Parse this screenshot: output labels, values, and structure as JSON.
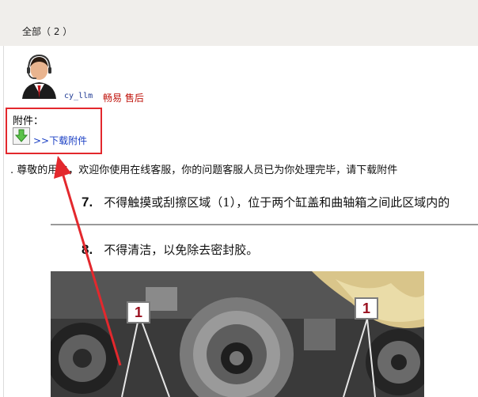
{
  "tabs": {
    "all_label": "全部（ 2 ）"
  },
  "reply": {
    "username": "cy_llm",
    "user_role": "畅易 售后",
    "avatar_icon": "customer-service-agent-avatar",
    "attachment_label": "附件：",
    "download_icon": "green-down-arrow-icon",
    "download_link": ">>下载附件",
    "message": ". 尊敬的用户，欢迎你使用在线客服，你的问题客服人员已为你处理完毕，请下载附件"
  },
  "attachment_image": {
    "item7_number": "7.",
    "item7_text": "不得触摸或刮擦区域（1），位于两个缸盖和曲轴箱之间此区域内的",
    "item8_number": "8.",
    "item8_text": "不得清洁，以免除去密封胶。",
    "callout_left": "1",
    "callout_right": "1"
  },
  "colors": {
    "highlight_box": "#e3282d",
    "username": "#1f3a93",
    "role": "#c0140c",
    "link": "#1a3fc4",
    "band": "#f0eeeb"
  }
}
